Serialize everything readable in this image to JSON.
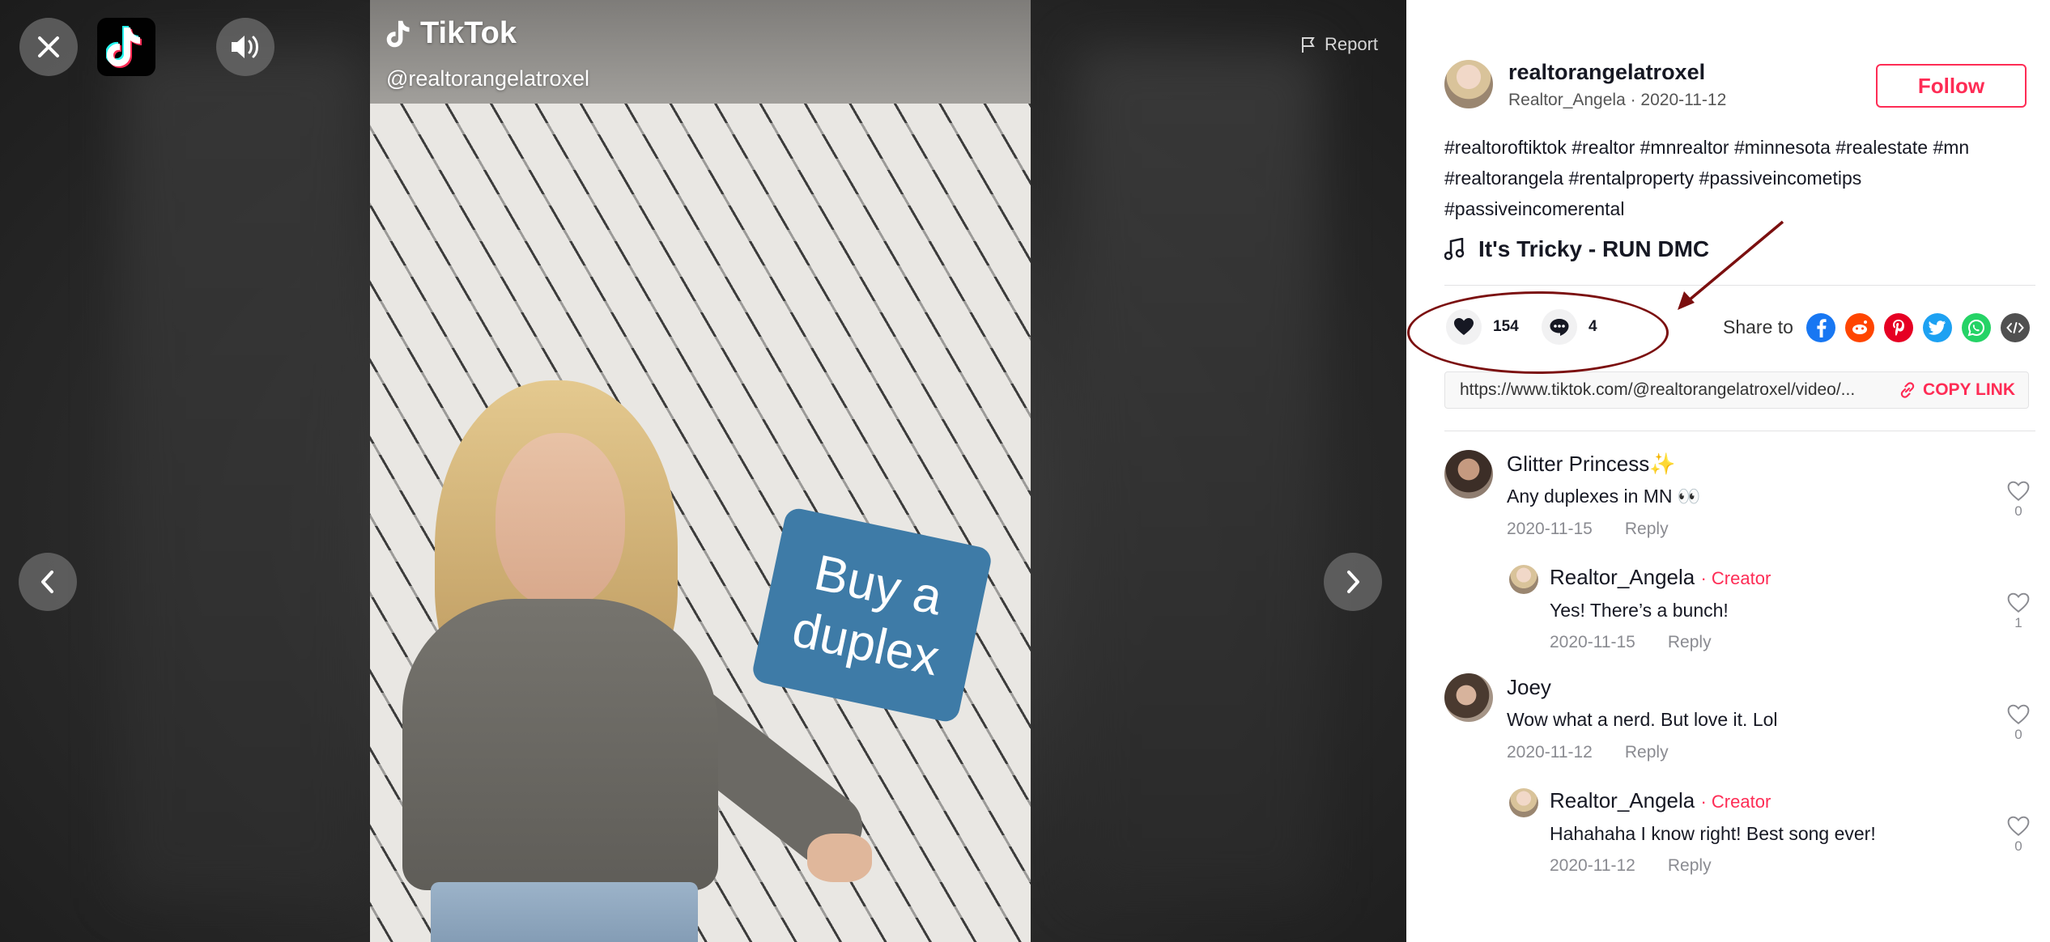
{
  "video": {
    "watermark_name": "TikTok",
    "watermark_handle": "@realtorangelatroxel",
    "sticker_line1": "Buy a",
    "sticker_line2": "duplex",
    "report_label": "Report"
  },
  "author": {
    "username": "realtorangelatroxel",
    "subline": "Realtor_Angela · 2020-11-12",
    "follow_label": "Follow"
  },
  "description": {
    "hashtags": [
      "#realtoroftiktok",
      "#realtor",
      "#mnrealtor",
      "#minnesota",
      "#realestate",
      "#mn",
      "#realtorangela",
      "#rentalproperty",
      "#passiveincometips",
      "#passiveincomerental"
    ]
  },
  "music": {
    "title": "It's Tricky - RUN DMC"
  },
  "stats": {
    "likes": "154",
    "comments": "4"
  },
  "share": {
    "label": "Share to",
    "icons": [
      "facebook-icon",
      "reddit-icon",
      "pinterest-icon",
      "twitter-icon",
      "whatsapp-icon",
      "embed-icon"
    ],
    "colors": {
      "facebook": "#1877f2",
      "reddit": "#ff4500",
      "pinterest": "#e60023",
      "twitter": "#1da1f2",
      "whatsapp": "#25d366",
      "embed": "#505050"
    }
  },
  "link": {
    "url": "https://www.tiktok.com/@realtorangelatroxel/video/...",
    "copy_label": "COPY LINK"
  },
  "comments": [
    {
      "name": "Glitter Princess✨",
      "creator": "",
      "text": "Any duplexes in MN 👀",
      "date": "2020-11-15",
      "reply": "Reply",
      "likes": "0"
    },
    {
      "name": "Realtor_Angela",
      "creator": "· Creator",
      "text": "Yes! There’s a bunch!",
      "date": "2020-11-15",
      "reply": "Reply",
      "likes": "1"
    },
    {
      "name": "Joey",
      "creator": "",
      "text": "Wow what a nerd. But love it. Lol",
      "date": "2020-11-12",
      "reply": "Reply",
      "likes": "0"
    },
    {
      "name": "Realtor_Angela",
      "creator": "· Creator",
      "text": "Hahahaha I know right! Best song ever!",
      "date": "2020-11-12",
      "reply": "Reply",
      "likes": "0"
    }
  ],
  "colors": {
    "accent": "#fe2c55",
    "annotation": "#7b0f0f"
  }
}
